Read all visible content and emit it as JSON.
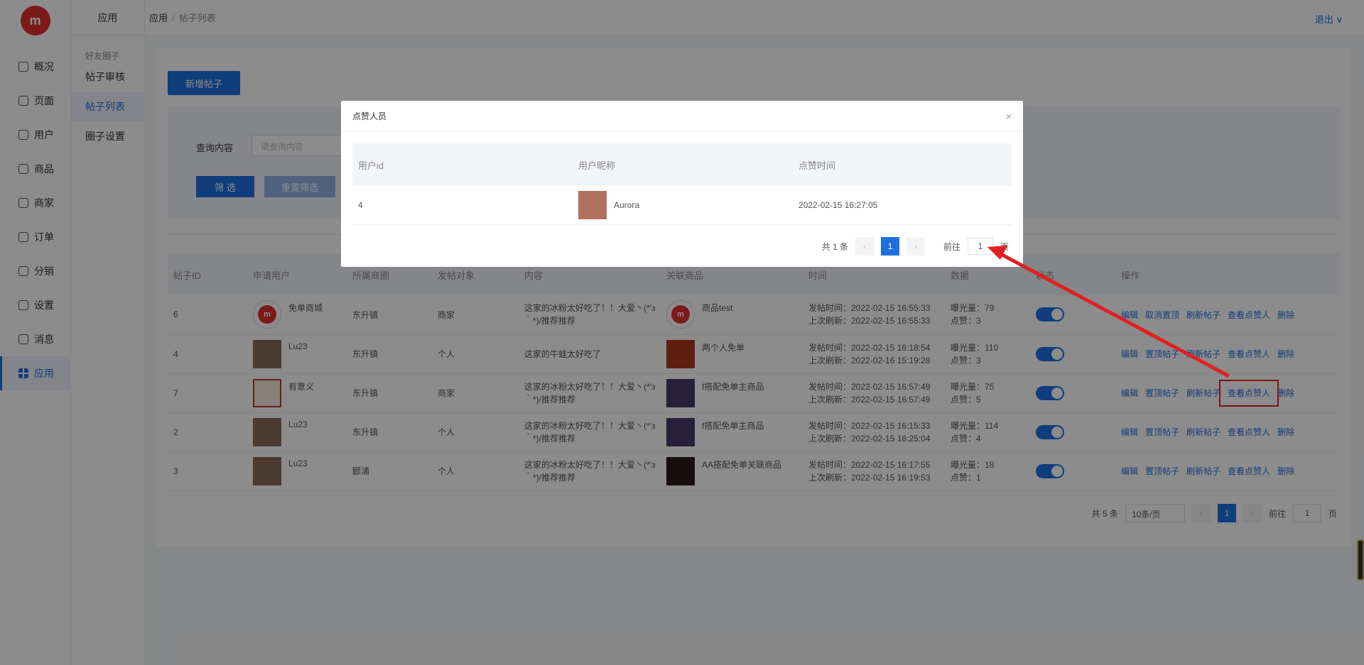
{
  "nav": {
    "logo": "m",
    "items": [
      {
        "label": "概况"
      },
      {
        "label": "页面"
      },
      {
        "label": "用户"
      },
      {
        "label": "商品"
      },
      {
        "label": "商家"
      },
      {
        "label": "订单"
      },
      {
        "label": "分销"
      },
      {
        "label": "设置"
      },
      {
        "label": "消息"
      },
      {
        "label": "应用"
      }
    ]
  },
  "subnav": {
    "title": "应用",
    "group": "好友圈子",
    "items": [
      {
        "label": "帖子审核"
      },
      {
        "label": "帖子列表"
      },
      {
        "label": "圈子设置"
      }
    ]
  },
  "topbar": {
    "crumb1": "应用",
    "sep": "/",
    "crumb2": "帖子列表",
    "logout": "退出 ∨"
  },
  "toolbar": {
    "add_label": "新增帖子"
  },
  "filter": {
    "label": "查询内容",
    "placeholder": "请查询内容",
    "search_label": "筛 选",
    "reset_label": "重置筛选"
  },
  "table": {
    "headers": [
      "帖子ID",
      "申请用户",
      "所属商圈",
      "发帖对象",
      "内容",
      "关联商品",
      "时间",
      "数据",
      "状态",
      "操作"
    ],
    "rows": [
      {
        "id": "6",
        "user": "免单商城",
        "area": "东升镇",
        "target": "商家",
        "content": "这家的冰粉太好吃了！！大爱丶(*'з｀*)/推荐推荐",
        "product": "商品test",
        "post_time": "发帖时间：2022-02-15 16:55:33",
        "refresh_time": "上次刷新：2022-02-15 16:55:33",
        "views": "曝光量：79",
        "likes": "点赞：3",
        "op_top": "取消置顶"
      },
      {
        "id": "4",
        "user": "Lu23",
        "area": "东升镇",
        "target": "个人",
        "content": "这家的牛蛙太好吃了",
        "product": "两个人免单",
        "post_time": "发帖时间：2022-02-15 16:18:54",
        "refresh_time": "上次刷新：2022-02-16 15:19:28",
        "views": "曝光量：110",
        "likes": "点赞：3",
        "op_top": "置顶帖子"
      },
      {
        "id": "7",
        "user": "有意义",
        "area": "东升镇",
        "target": "商家",
        "content": "这家的冰粉太好吃了！！大爱丶(*'з｀*)/推荐推荐",
        "product": "f搭配免单主商品",
        "post_time": "发帖时间：2022-02-15 16:57:49",
        "refresh_time": "上次刷新：2022-02-15 16:57:49",
        "views": "曝光量：75",
        "likes": "点赞：5",
        "op_top": "置顶帖子"
      },
      {
        "id": "2",
        "user": "Lu23",
        "area": "东升镇",
        "target": "个人",
        "content": "这家的冰粉太好吃了！！大爱丶(*'з｀*)/推荐推荐",
        "product": "f搭配免单主商品",
        "post_time": "发帖时间：2022-02-15 16:15:33",
        "refresh_time": "上次刷新：2022-02-15 16:25:04",
        "views": "曝光量：114",
        "likes": "点赞：4",
        "op_top": "置顶帖子"
      },
      {
        "id": "3",
        "user": "Lu23",
        "area": "郾浦",
        "target": "个人",
        "content": "这家的冰粉太好吃了！！大爱丶(*'з｀*)/推荐推荐",
        "product": "AA搭配免单关联商品",
        "post_time": "发帖时间：2022-02-15 16:17:55",
        "refresh_time": "上次刷新：2022-02-15 16:19:53",
        "views": "曝光量：18",
        "likes": "点赞：1",
        "op_top": "置顶帖子"
      }
    ],
    "ops": {
      "edit": "编辑",
      "refresh": "刷新帖子",
      "likers": "查看点赞人",
      "delete": "删除"
    }
  },
  "pager": {
    "total": "共 5 条",
    "size": "10条/页",
    "page": "1",
    "goto": "前往",
    "goto_val": "1",
    "unit": "页",
    "prev": "‹",
    "next": "›"
  },
  "dialog": {
    "title": "点赞人员",
    "close": "×",
    "headers": [
      "用户id",
      "用户昵称",
      "点赞时间"
    ],
    "rows": [
      {
        "uid": "4",
        "nick": "Aurora",
        "time": "2022-02-15 16:27:05"
      }
    ],
    "pager": {
      "total": "共 1 条",
      "page": "1",
      "goto": "前往",
      "goto_val": "1",
      "unit": "页",
      "prev": "‹",
      "next": "›"
    }
  },
  "colors": {
    "accent": "#1e6fe0",
    "annotation": "#e02020"
  }
}
